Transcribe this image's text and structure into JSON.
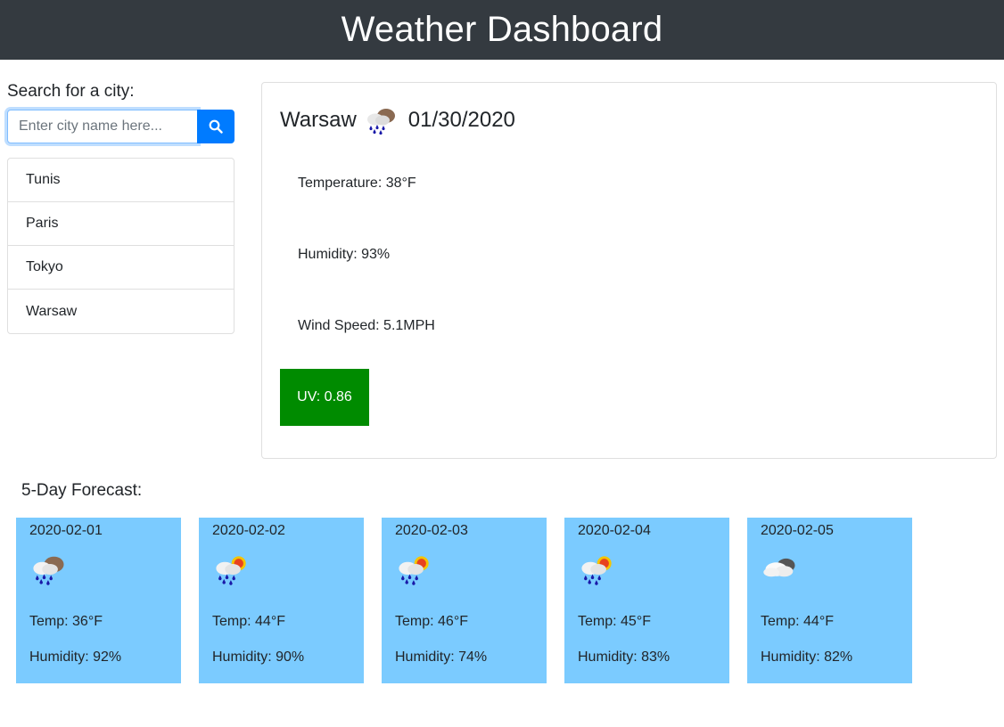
{
  "header": {
    "title": "Weather Dashboard"
  },
  "search": {
    "label": "Search for a city:",
    "placeholder": "Enter city name here...",
    "button_icon": "search-icon"
  },
  "history": [
    {
      "label": "Tunis"
    },
    {
      "label": "Paris"
    },
    {
      "label": "Tokyo"
    },
    {
      "label": "Warsaw"
    }
  ],
  "current": {
    "city": "Warsaw",
    "icon": "rain-cloud-icon",
    "date": "01/30/2020",
    "temperature": "Temperature: 38°F",
    "humidity": "Humidity: 93%",
    "wind": "Wind Speed: 5.1MPH",
    "uv": "UV: 0.86",
    "uv_color": "#008b00"
  },
  "forecast": {
    "title": "5-Day Forecast:",
    "card_color": "#7bcbff",
    "days": [
      {
        "date": "2020-02-01",
        "icon": "rain-cloud-icon",
        "temp": "Temp: 36°F",
        "humidity": "Humidity: 92%"
      },
      {
        "date": "2020-02-02",
        "icon": "sun-rain-cloud-icon",
        "temp": "Temp: 44°F",
        "humidity": "Humidity: 90%"
      },
      {
        "date": "2020-02-03",
        "icon": "sun-rain-cloud-icon",
        "temp": "Temp: 46°F",
        "humidity": "Humidity: 74%"
      },
      {
        "date": "2020-02-04",
        "icon": "sun-rain-cloud-icon",
        "temp": "Temp: 45°F",
        "humidity": "Humidity: 83%"
      },
      {
        "date": "2020-02-05",
        "icon": "cloud-icon",
        "temp": "Temp: 44°F",
        "humidity": "Humidity: 82%"
      }
    ]
  }
}
